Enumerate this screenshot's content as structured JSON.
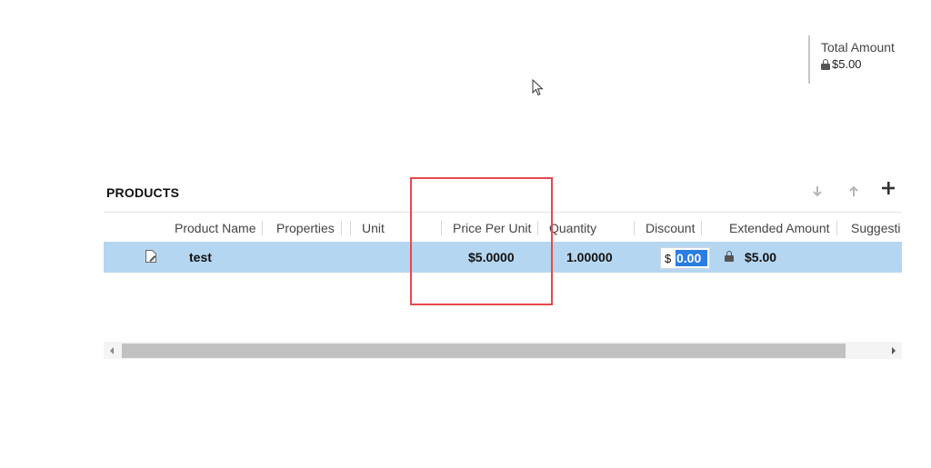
{
  "total": {
    "label": "Total Amount",
    "value": "$5.00"
  },
  "products": {
    "title": "PRODUCTS",
    "toolbar": {
      "move_down": "arrow-down-icon",
      "move_up": "arrow-up-icon",
      "add": "plus-icon"
    },
    "columns": [
      "Product Name",
      "Properties",
      "Unit",
      "Price Per Unit",
      "Quantity",
      "Discount",
      "Extended Amount",
      "Suggesti"
    ],
    "row": {
      "product_name": "test",
      "properties": "",
      "unit": "",
      "price_per_unit": "$5.0000",
      "quantity": "1.00000",
      "discount_currency": "$",
      "discount_value": "0.00",
      "extended_amount": "$5.00"
    }
  },
  "colors": {
    "selected_row": "#b5d6f0",
    "highlight_border": "#e8484d",
    "input_selection": "#2a7de1"
  }
}
